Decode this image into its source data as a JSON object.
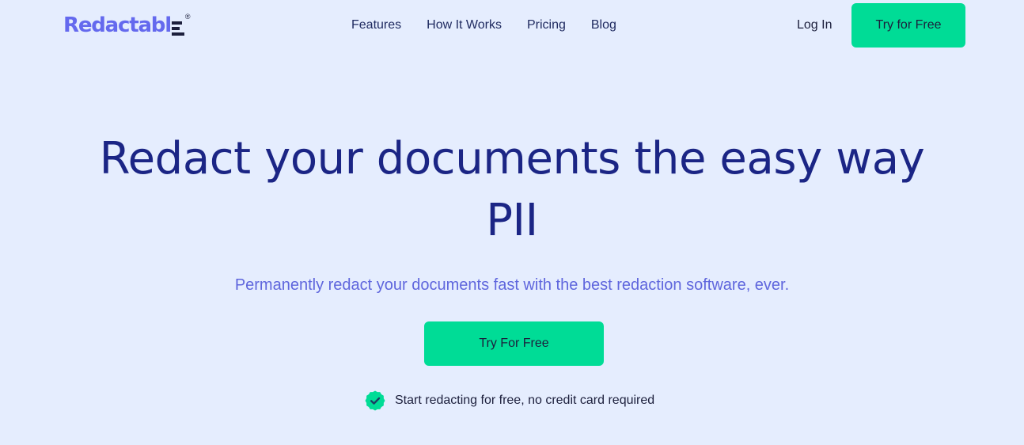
{
  "header": {
    "logo_text": "Redactabl",
    "logo_mark": "®",
    "nav": [
      {
        "label": "Features"
      },
      {
        "label": "How It Works"
      },
      {
        "label": "Pricing"
      },
      {
        "label": "Blog"
      }
    ],
    "login_label": "Log In",
    "cta_label": "Try for Free"
  },
  "hero": {
    "title_line1": "Redact your documents the easy way",
    "title_line2": "PII",
    "subtitle": "Permanently redact your documents fast with the best redaction software, ever.",
    "cta_label": "Try For Free",
    "note": "Start redacting for free, no credit card required",
    "note_icon": "verified-badge-icon"
  },
  "colors": {
    "background": "#e5edfe",
    "accent_green": "#00dc96",
    "title_navy": "#1b2585",
    "subtitle_purple": "#5f66dd",
    "logo_purple": "#6469ee"
  }
}
